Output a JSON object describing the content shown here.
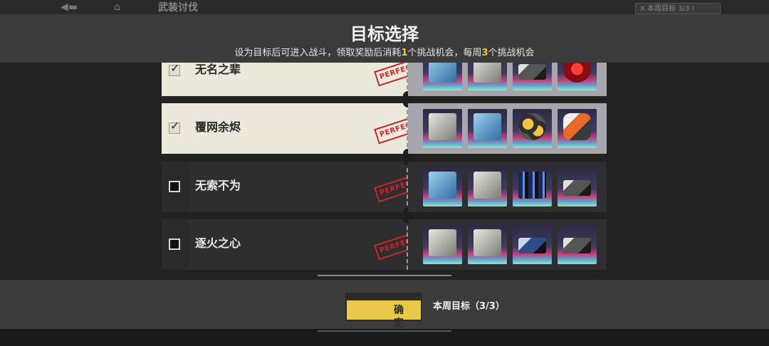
{
  "background": {
    "title": "武装讨伐",
    "badge": "X 本周目标 3/3 !"
  },
  "modal": {
    "title": "目标选择",
    "subtitle_pre": "设为目标后可进入战斗，领取奖励后消耗",
    "subtitle_n1": "1",
    "subtitle_mid": "个挑战机会，每周",
    "subtitle_n2": "3",
    "subtitle_post": "个挑战机会"
  },
  "stamp_text": "PERFECT",
  "rows": [
    {
      "label": "无名之辈",
      "selected": true,
      "items": [
        "book-blue-icon",
        "book-grey-icon",
        "gun-dark-icon",
        "red-core-icon"
      ]
    },
    {
      "label": "覆网余烬",
      "selected": true,
      "items": [
        "book-grey-icon",
        "book-blue-icon",
        "core-gold-icon",
        "core-orange-icon"
      ]
    },
    {
      "label": "无索不为",
      "selected": false,
      "items": [
        "book-blue-icon",
        "book-grey-icon",
        "rails-icon",
        "gun-dark-icon"
      ]
    },
    {
      "label": "逐火之心",
      "selected": false,
      "items": [
        "book-grey-icon",
        "book-grey-icon",
        "gun-blue-icon",
        "gun-dark-icon"
      ]
    }
  ],
  "footer": {
    "confirm_label": "确定",
    "weekly_target": "本周目标（3/3）"
  },
  "colors": {
    "accent": "#f2c33a",
    "confirm_button": "#e9c84a",
    "stamp": "#c8262e"
  }
}
